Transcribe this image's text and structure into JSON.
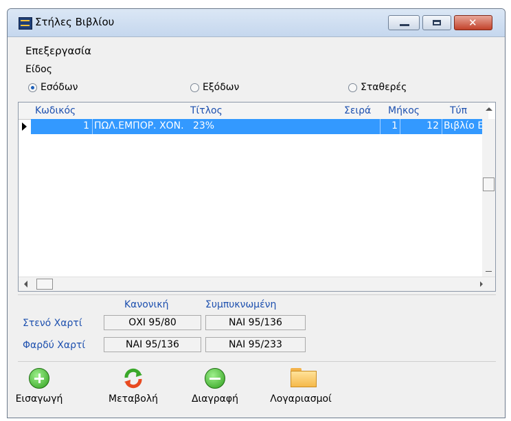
{
  "window": {
    "title": "Στήλες Βιβλίου",
    "minimize_glyph": "",
    "maximize_glyph": "",
    "close_glyph": "✕"
  },
  "menu": {
    "label": "Επεξεργασία"
  },
  "type_group": {
    "label": "Είδος",
    "options": [
      "Εσόδων",
      "Εξόδων",
      "Σταθερές"
    ],
    "selected": "Εσόδων"
  },
  "grid": {
    "columns": [
      "Κωδικός",
      "Τίτλος",
      "Σειρά",
      "Μήκος",
      "Τύπ"
    ],
    "rows": [
      {
        "code": "1",
        "title": "ΠΩΛ.ΕΜΠΟΡ. ΧΟΝ.   23%",
        "order": "1",
        "length": "12",
        "type": "Βιβλίο Εσ"
      }
    ]
  },
  "formats": {
    "col_normal": "Κανονική",
    "col_compressed": "Συμπυκνωμένη",
    "row_narrow": "Στενό Χαρτί",
    "row_wide": "Φαρδύ Χαρτί",
    "narrow_normal": "ΟΧΙ 95/80",
    "narrow_compressed": "ΝΑΙ 95/136",
    "wide_normal": "ΝΑΙ 95/136",
    "wide_compressed": "ΝΑΙ 95/233"
  },
  "toolbar": {
    "insert": "Εισαγωγή",
    "modify": "Μεταβολή",
    "delete": "Διαγραφή",
    "accounts": "Λογαριασμοί"
  },
  "colors": {
    "selection": "#3399ff",
    "header_text": "#1c4fae",
    "close_button": "#c2412a"
  }
}
